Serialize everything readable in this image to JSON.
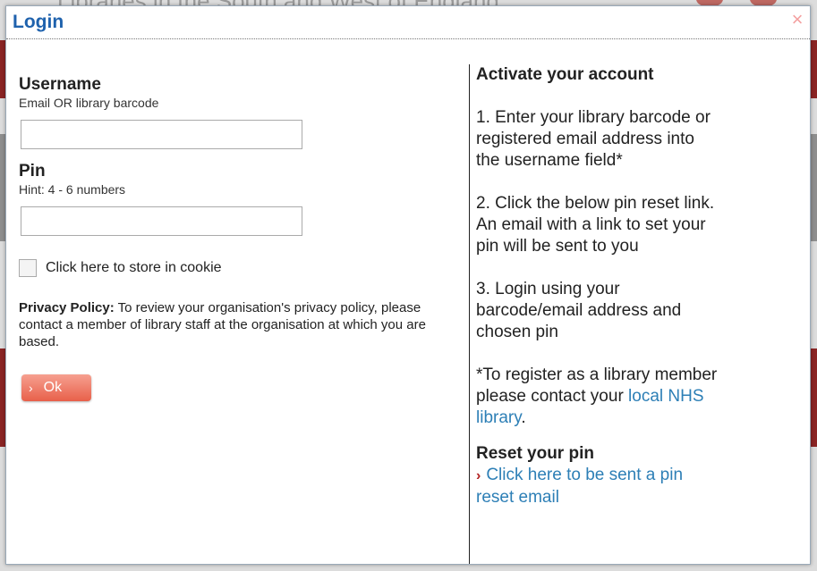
{
  "background": {
    "title": "Libraries in the South and West of England"
  },
  "modal": {
    "title": "Login",
    "close_icon": "×"
  },
  "form": {
    "username_label": "Username",
    "username_hint": "Email OR library barcode",
    "username_value": "",
    "pin_label": "Pin",
    "pin_hint": "Hint: 4 - 6 numbers",
    "pin_value": "",
    "cookie_label": "Click here to store in cookie",
    "cookie_checked": false,
    "privacy_bold": "Privacy Policy:",
    "privacy_text": " To review your organisation's privacy policy, please contact a member of library staff at the organisation at which you are based.",
    "ok_label": "Ok",
    "ok_chevron": "›"
  },
  "activate": {
    "heading": "Activate your account",
    "step1": "1. Enter your library barcode or registered email address into the username field*",
    "step2": "2. Click the below pin reset link. An email with a link to set your pin will be sent to you",
    "step3": "3. Login using your barcode/email address and chosen pin",
    "register_text": "*To register as a library member please contact your ",
    "register_link": "local NHS library",
    "register_end": "."
  },
  "reset": {
    "heading": "Reset your pin",
    "chevron": "›",
    "link": "Click here to be sent a pin reset email"
  },
  "colors": {
    "title": "#1f62ad",
    "link": "#2d7fb6",
    "ok_button": "#e8604a",
    "chevron": "#b22222"
  }
}
